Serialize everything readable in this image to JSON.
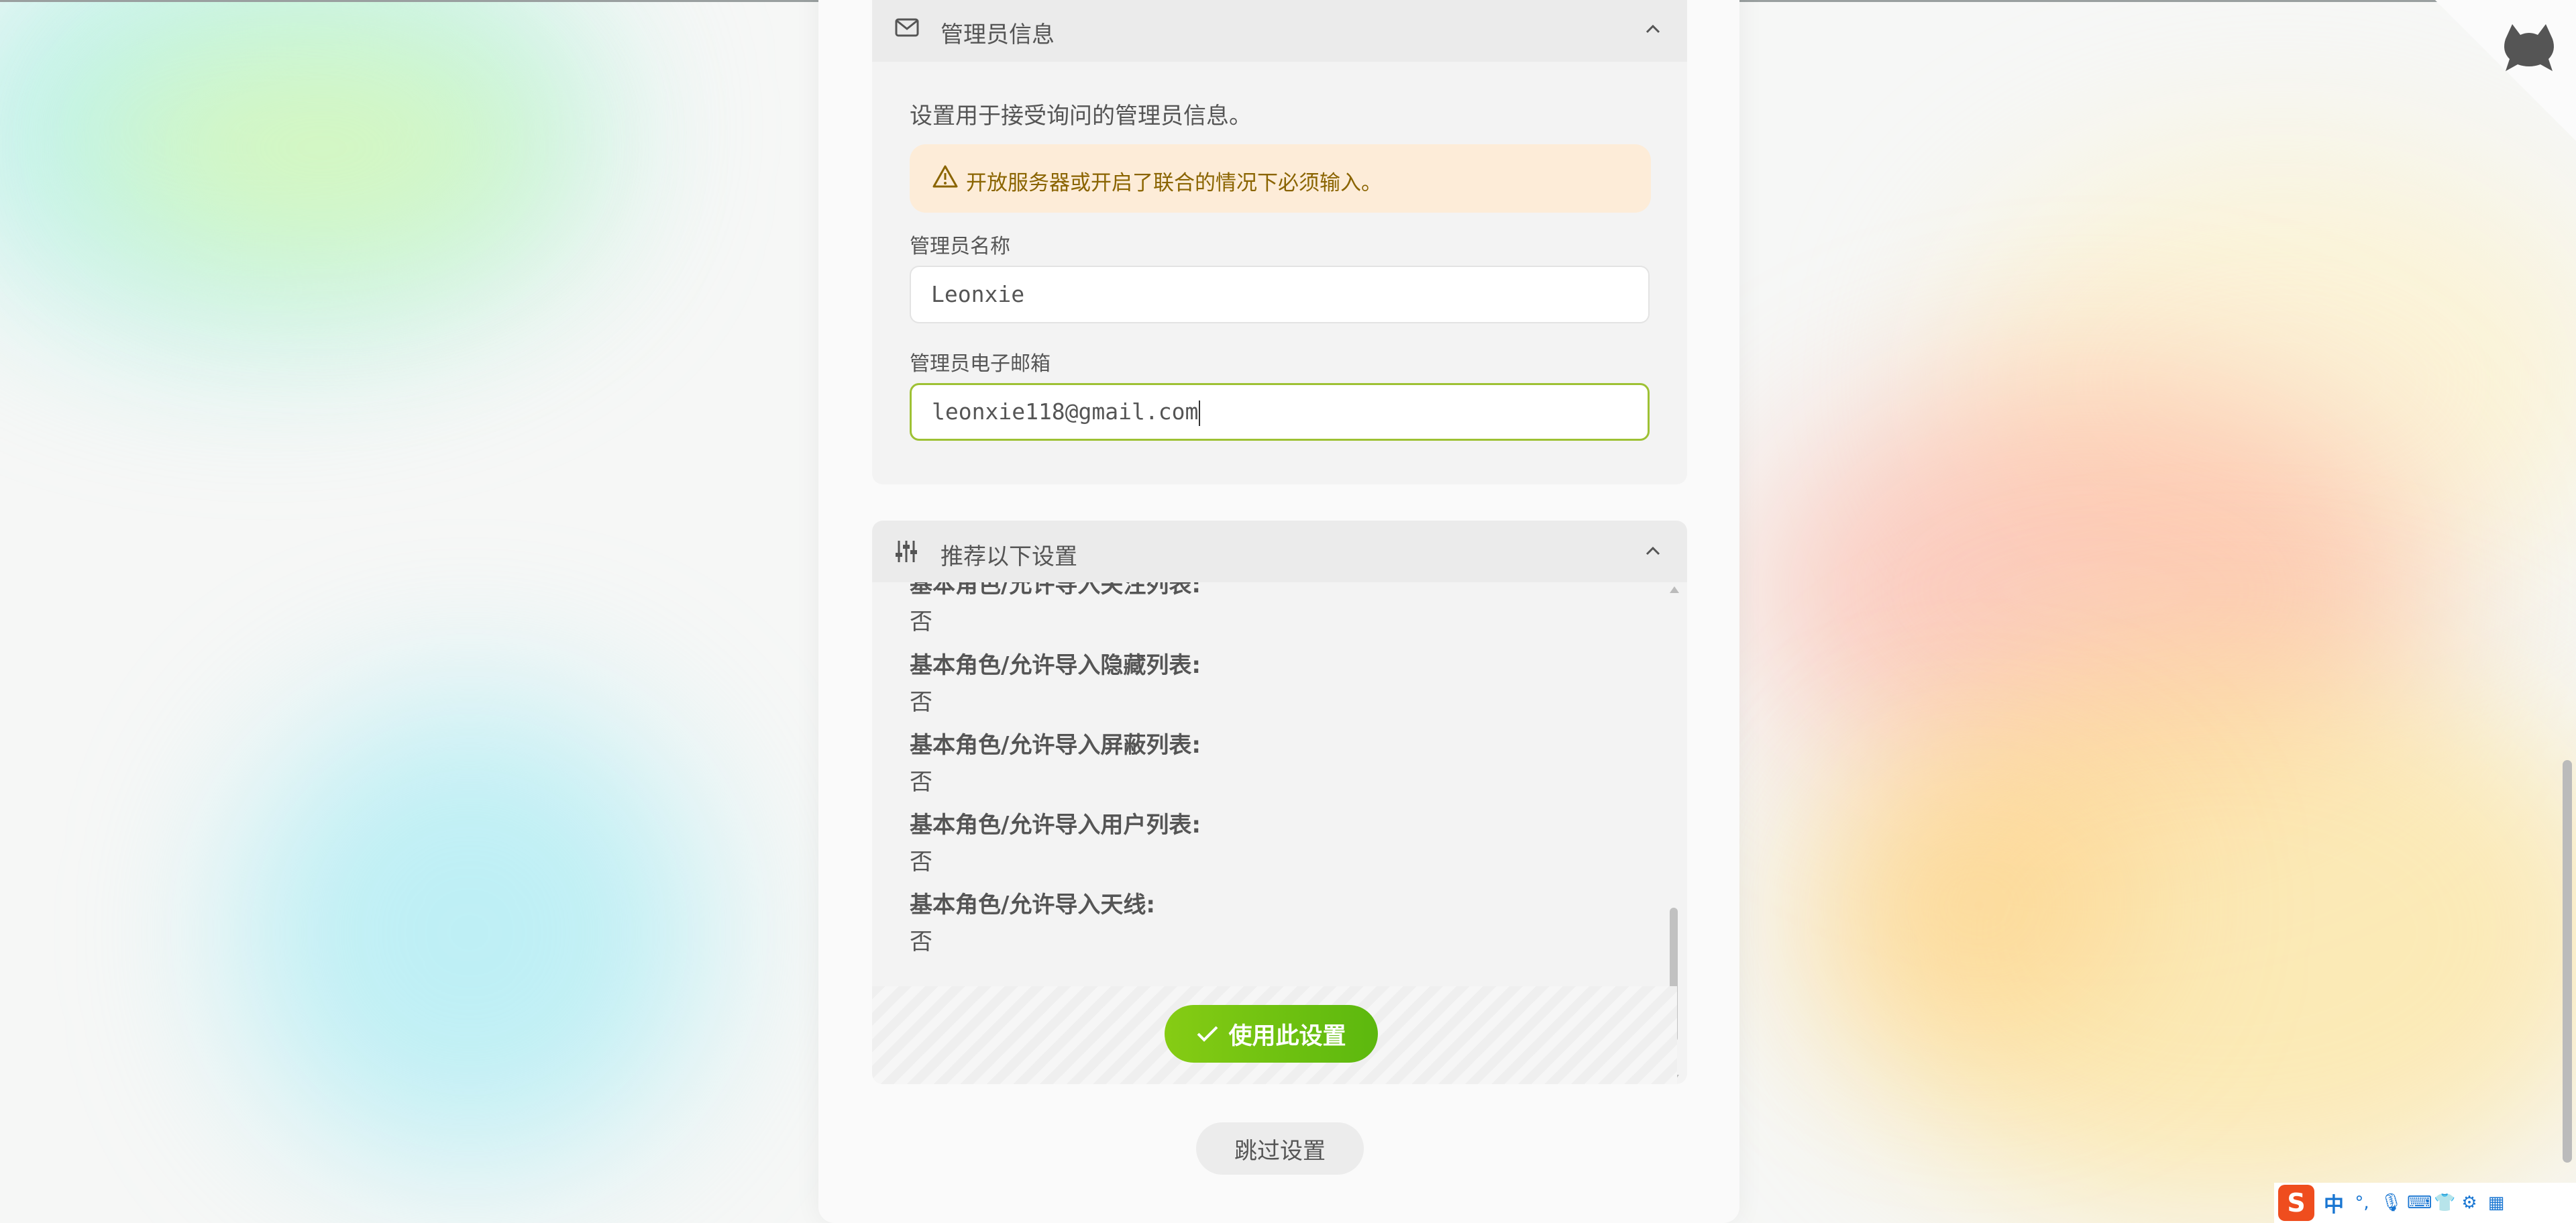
{
  "admin_section": {
    "title": "管理员信息",
    "description": "设置用于接受询问的管理员信息。",
    "warning": "开放服务器或开启了联合的情况下必须输入。",
    "name_label": "管理员名称",
    "name_value": "Leonxie",
    "email_label": "管理员电子邮箱",
    "email_value": "leonxie118@gmail.com"
  },
  "recommend_section": {
    "title": "推荐以下设置",
    "items": [
      {
        "label": "基本角色/允许导入关注列表:",
        "value": "否"
      },
      {
        "label": "基本角色/允许导入隐藏列表:",
        "value": "否"
      },
      {
        "label": "基本角色/允许导入屏蔽列表:",
        "value": "否"
      },
      {
        "label": "基本角色/允许导入用户列表:",
        "value": "否"
      },
      {
        "label": "基本角色/允许导入天线:",
        "value": "否"
      }
    ],
    "use_button": "使用此设置"
  },
  "skip_button": "跳过设置",
  "ime": {
    "logo": "S",
    "mode": "中"
  },
  "icons": {
    "mail": "mail-icon",
    "sliders": "sliders-icon",
    "chevron": "chevron-up-icon",
    "warning": "warning-triangle-icon",
    "check": "check-icon",
    "cat": "cat-icon"
  }
}
